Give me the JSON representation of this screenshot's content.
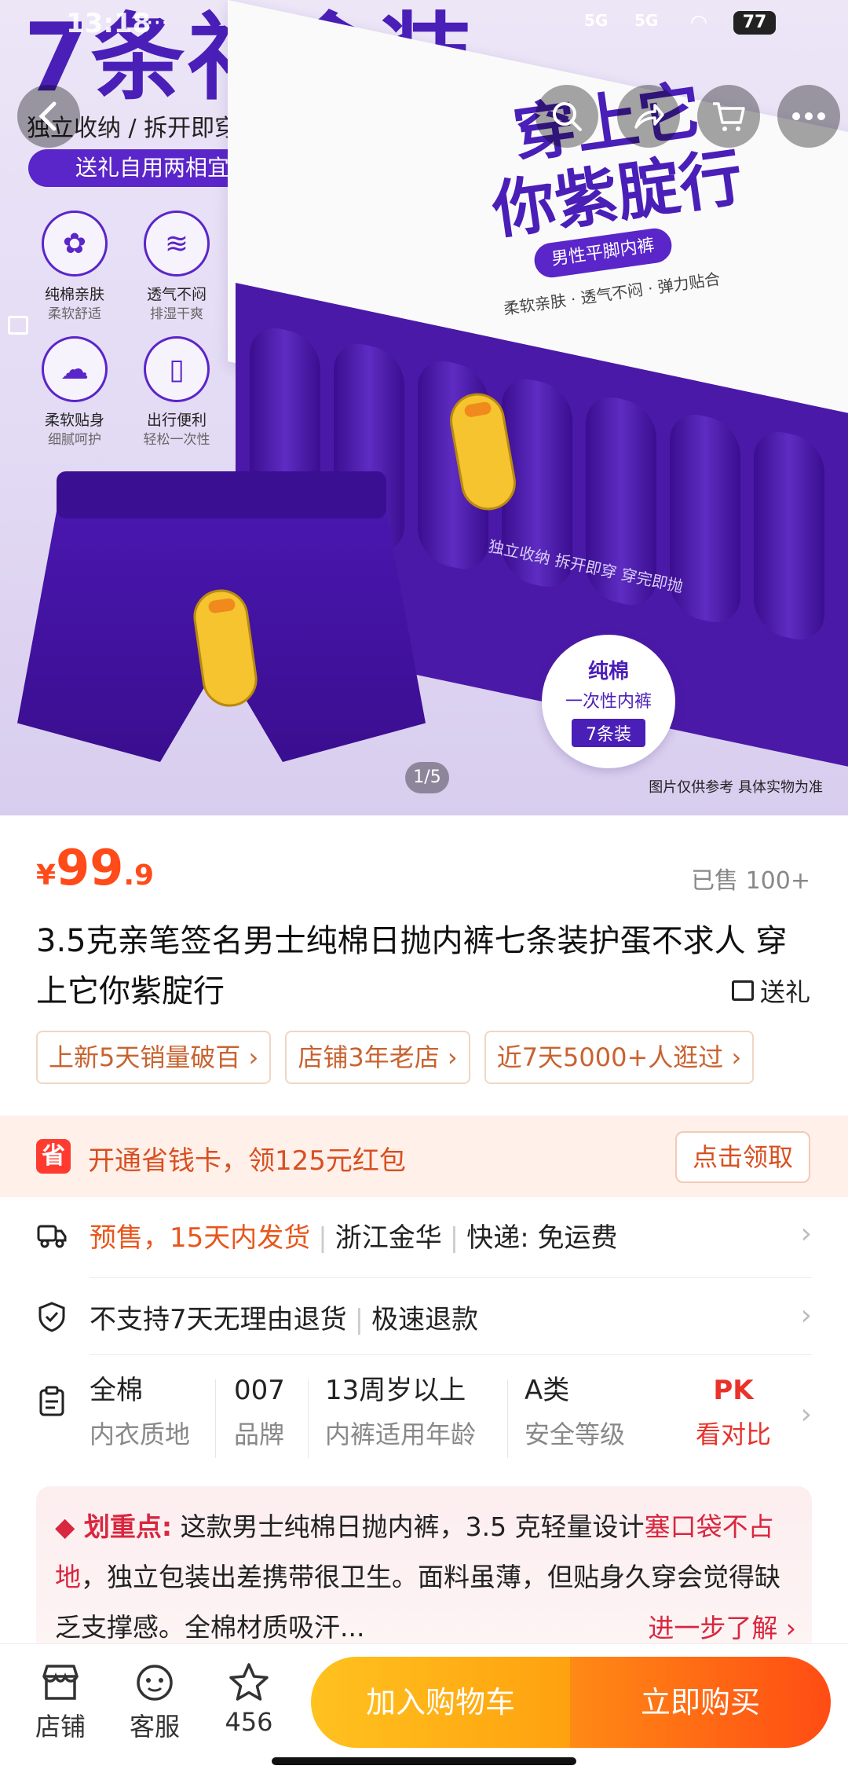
{
  "status_bar": {
    "time": "13:18",
    "dots": "···",
    "signal1": "5G",
    "signal2": "5G",
    "battery": "77"
  },
  "hero": {
    "title": "7条礼盒装",
    "tagline": "独立收纳 / 拆开即穿 / 穿完即抛",
    "pill": "送礼自用两相宜",
    "features": [
      {
        "title": "纯棉亲肤",
        "sub": "柔软舒适",
        "icon": "cotton-icon"
      },
      {
        "title": "透气不闷",
        "sub": "排湿干爽",
        "icon": "breathable-icon"
      },
      {
        "title": "柔软贴身",
        "sub": "细腻呵护",
        "icon": "cloud-icon"
      },
      {
        "title": "出行便利",
        "sub": "轻松一次性",
        "icon": "suitcase-icon"
      }
    ],
    "lid_line1": "穿上它",
    "lid_line2": "你紫腚行",
    "lid_pill": "男性平脚内裤",
    "lid_sub": "柔软亲肤 · 透气不闷 · 弹力贴合",
    "tray_text": "独立收纳  拆开即穿  穿完即抛",
    "badge_line1": "纯棉",
    "badge_line2": "一次性内裤",
    "badge_line3": "7条装",
    "disclaimer": "图片仅供参考 具体实物为准",
    "counter": "1/5"
  },
  "product": {
    "price_symbol": "¥",
    "price_int": "99",
    "price_dec": ".9",
    "sold": "已售 100+",
    "title": "3.5克亲笔签名男士纯棉日抛内裤七条装护蛋不求人 穿上它你紫腚行",
    "gift_label": "送礼",
    "tags": [
      "上新5天销量破百 ›",
      "店铺3年老店 ›",
      "近7天5000+人逛过 ›"
    ]
  },
  "coupon": {
    "icon_char": "省",
    "text": "开通省钱卡，领125元红包",
    "button": "点击领取"
  },
  "delivery": {
    "presale": "预售，15天内发货",
    "origin": "浙江金华",
    "shipping": "快递: 免运费"
  },
  "service": {
    "text1": "不支持7天无理由退货",
    "text2": "极速退款"
  },
  "specs": [
    {
      "value": "全棉",
      "key": "内衣质地"
    },
    {
      "value": "007",
      "key": "品牌"
    },
    {
      "value": "13周岁以上",
      "key": "内裤适用年龄"
    },
    {
      "value": "A类",
      "key": "安全等级"
    }
  ],
  "compare": {
    "value": "PK",
    "key": "看对比"
  },
  "summary": {
    "lead": "划重点:",
    "text_a": "这款男士纯棉日抛内裤，3.5 克轻量设计",
    "highlight": "塞口袋不占地",
    "text_b": "，独立包装出差携带很卫生。面料虽薄，但贴身久穿会觉得缺乏支撑感。全棉材质吸汗...",
    "more": "进一步了解 ›"
  },
  "bottom_bar": {
    "shop": "店铺",
    "service": "客服",
    "favorites": "456",
    "add_cart": "加入购物车",
    "buy_now": "立即购买"
  },
  "colors": {
    "brand_purple": "#4a1fb8",
    "price_orange": "#ff4a1a",
    "cart_yellow": "#ffb219",
    "buy_orange": "#ff5a14",
    "highlight_red": "#d8273f"
  }
}
